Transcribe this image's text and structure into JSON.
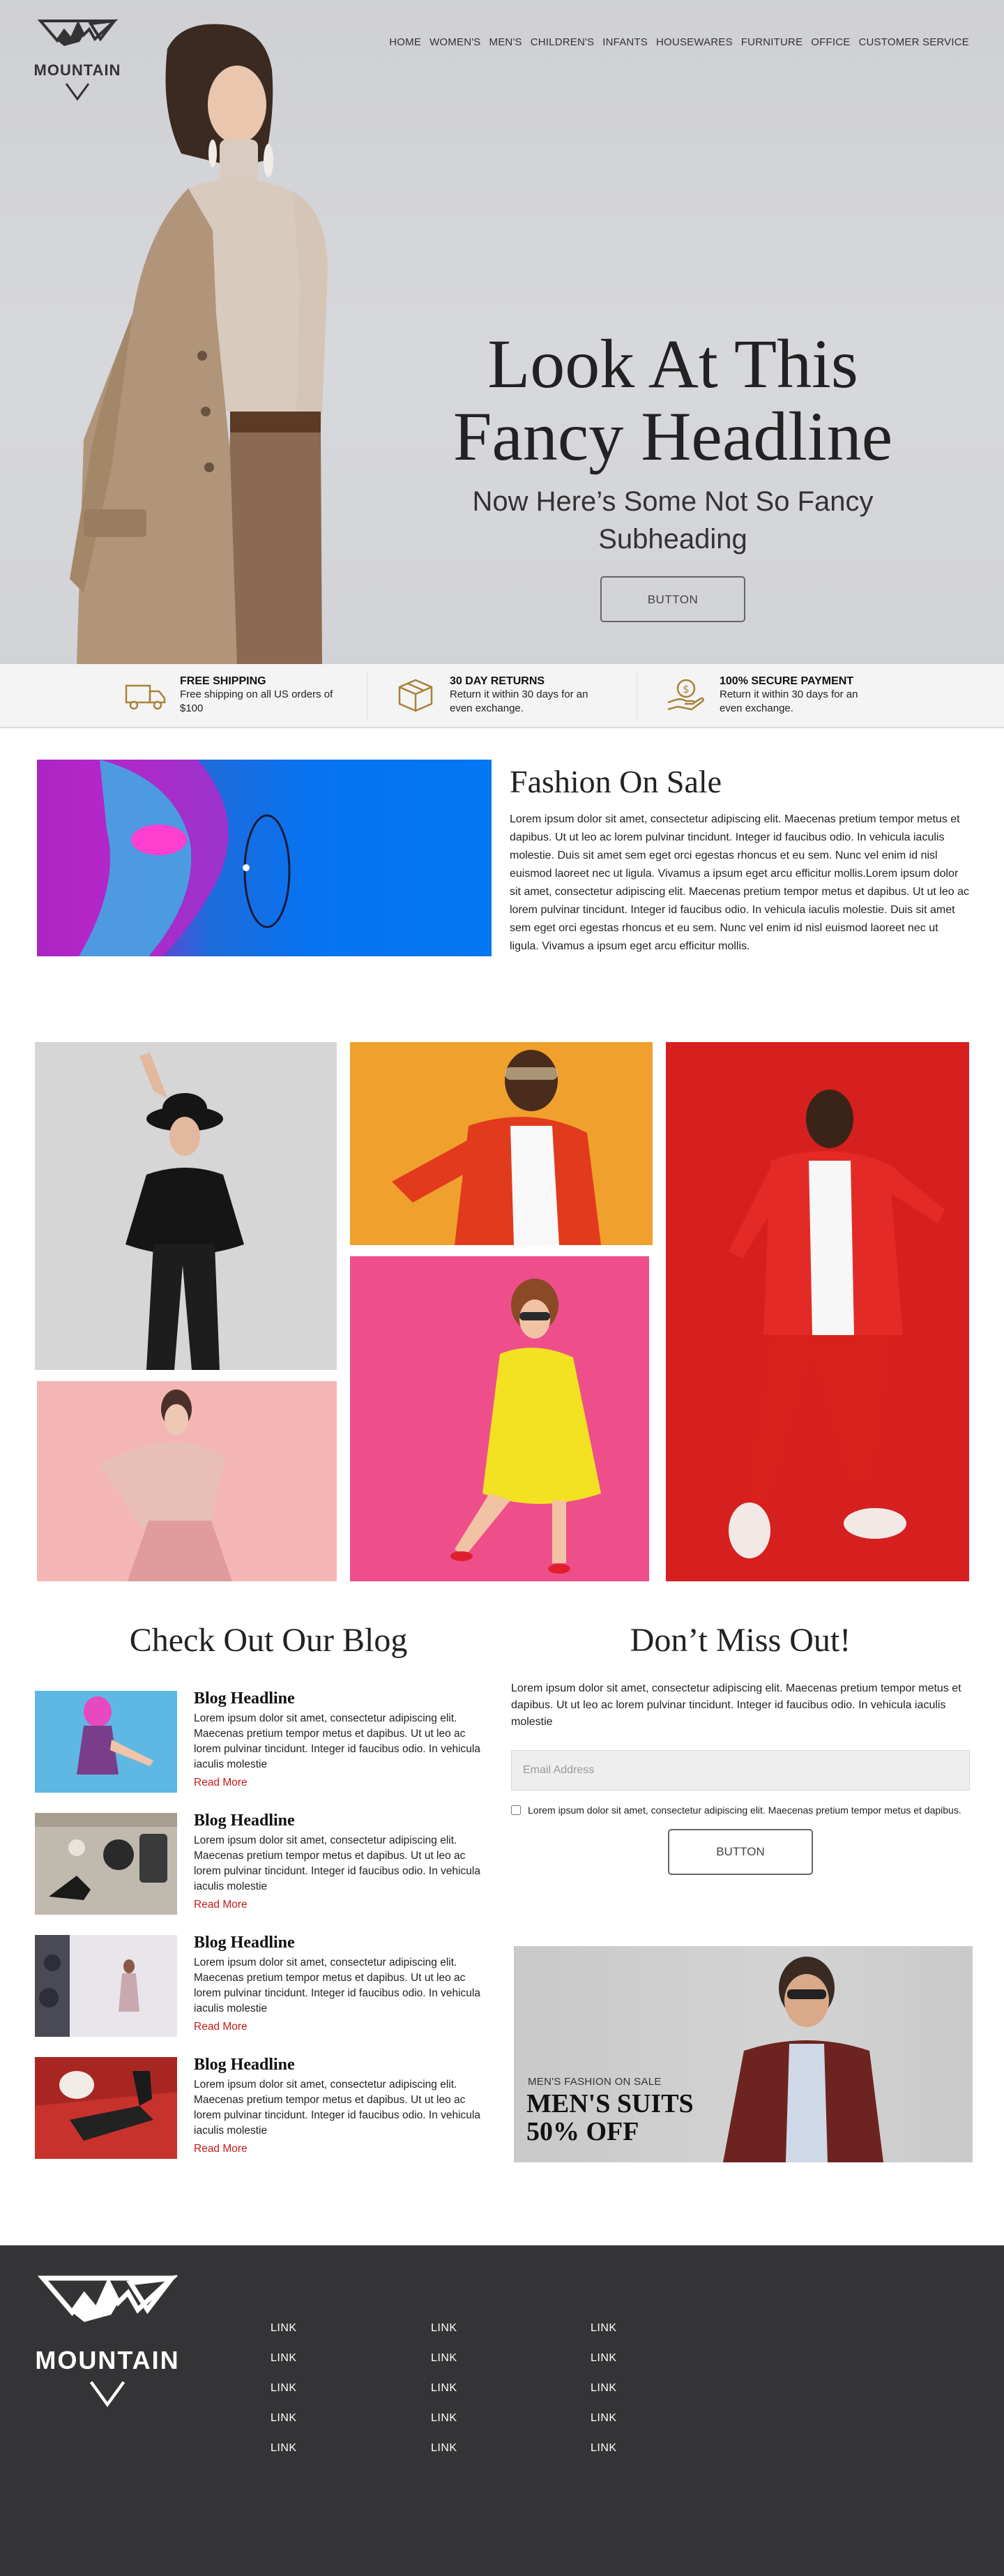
{
  "brand": {
    "name": "MOUNTAIN"
  },
  "nav": {
    "items": [
      "HOME",
      "WOMEN'S",
      "MEN'S",
      "CHILDREN'S",
      "INFANTS",
      "HOUSEWARES",
      "FURNITURE",
      "OFFICE",
      "CUSTOMER SERVICE"
    ]
  },
  "hero": {
    "title_line1": "Look At This",
    "title_line2": "Fancy Headline",
    "subtitle_line1": "Now Here’s Some Not So Fancy",
    "subtitle_line2": "Subheading",
    "button": "BUTTON"
  },
  "features": [
    {
      "title": "FREE SHIPPING",
      "desc": "Free shipping on all US orders of $100",
      "icon": "truck-icon"
    },
    {
      "title": "30 DAY RETURNS",
      "desc": "Return it within 30 days for an even exchange.",
      "icon": "box-icon"
    },
    {
      "title": "100% SECURE PAYMENT",
      "desc": "Return it within 30 days for an even exchange.",
      "icon": "hand-dollar-icon"
    }
  ],
  "sale": {
    "title": "Fashion On Sale",
    "body": "Lorem ipsum dolor sit amet, consectetur adipiscing elit. Maecenas pretium tempor metus et dapibus. Ut ut leo ac lorem pulvinar tincidunt. Integer id faucibus odio. In vehicula iaculis molestie. Duis sit amet sem eget orci egestas rhoncus et eu sem. Nunc vel enim id nisl euismod laoreet nec ut ligula. Vivamus a ipsum eget arcu efficitur mollis.Lorem ipsum dolor sit amet, consectetur adipiscing elit. Maecenas pretium tempor metus et dapibus. Ut ut leo ac lorem pulvinar tincidunt. Integer id faucibus odio. In vehicula iaculis molestie. Duis sit amet sem eget orci egestas rhoncus et eu sem. Nunc vel enim id nisl euismod laoreet nec ut ligula. Vivamus a ipsum eget arcu efficitur mollis."
  },
  "blog": {
    "title": "Check Out Our Blog",
    "posts": [
      {
        "headline": "Blog Headline",
        "body": "Lorem ipsum dolor sit amet, consectetur adipiscing elit. Maecenas pretium tempor metus et dapibus. Ut ut leo ac lorem pulvinar tincidunt. Integer id faucibus odio. In vehicula iaculis molestie",
        "link": "Read More"
      },
      {
        "headline": "Blog Headline",
        "body": "Lorem ipsum dolor sit amet, consectetur adipiscing elit. Maecenas pretium tempor metus et dapibus. Ut ut leo ac lorem pulvinar tincidunt. Integer id faucibus odio. In vehicula iaculis molestie",
        "link": "Read More"
      },
      {
        "headline": "Blog Headline",
        "body": "Lorem ipsum dolor sit amet, consectetur adipiscing elit. Maecenas pretium tempor metus et dapibus. Ut ut leo ac lorem pulvinar tincidunt. Integer id faucibus odio. In vehicula iaculis molestie",
        "link": "Read More"
      },
      {
        "headline": "Blog Headline",
        "body": "Lorem ipsum dolor sit amet, consectetur adipiscing elit. Maecenas pretium tempor metus et dapibus. Ut ut leo ac lorem pulvinar tincidunt. Integer id faucibus odio. In vehicula iaculis molestie",
        "link": "Read More"
      }
    ]
  },
  "newsletter": {
    "title": "Don’t Miss Out!",
    "body": "Lorem ipsum dolor sit amet, consectetur adipiscing elit. Maecenas pretium tempor metus et dapibus. Ut ut leo ac lorem pulvinar tincidunt. Integer id faucibus odio. In vehicula iaculis molestie",
    "email_placeholder": "Email Address",
    "consent": "Lorem ipsum dolor sit amet, consectetur adipiscing elit. Maecenas pretium tempor metus et dapibus.",
    "button": "BUTTON"
  },
  "promo": {
    "kicker": "MEN'S FASHION ON SALE",
    "headline_line1": "MEN'S SUITS",
    "headline_line2": "50% OFF"
  },
  "footer": {
    "columns": [
      [
        "LINK",
        "LINK",
        "LINK",
        "LINK",
        "LINK"
      ],
      [
        "LINK",
        "LINK",
        "LINK",
        "LINK",
        "LINK"
      ],
      [
        "LINK",
        "LINK",
        "LINK",
        "LINK",
        "LINK"
      ]
    ]
  },
  "colors": {
    "accent_red": "#c41b1b",
    "footer_bg": "#343436",
    "feature_icon": "#a8823a"
  }
}
